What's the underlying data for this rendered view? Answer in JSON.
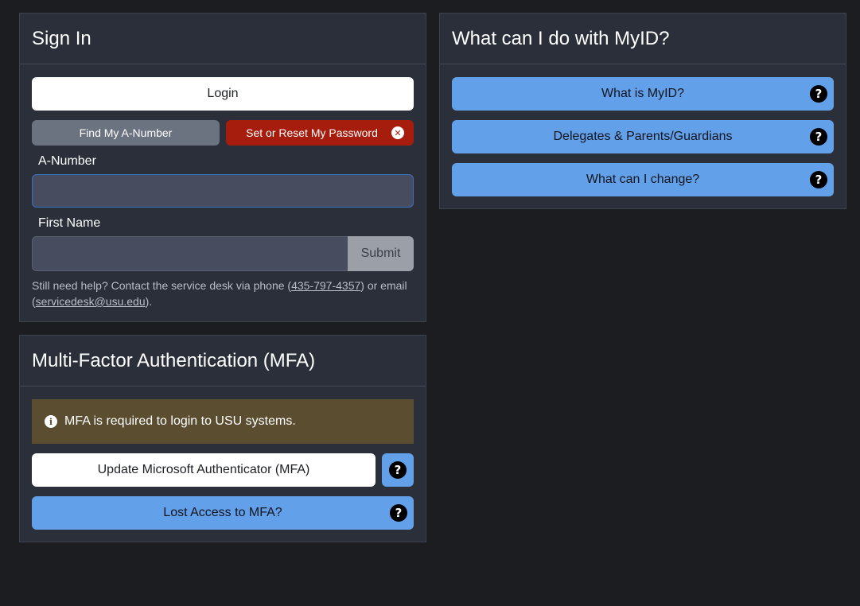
{
  "sign_in": {
    "title": "Sign In",
    "login_label": "Login",
    "find_anumber_label": "Find My A-Number",
    "reset_password_label": "Set or Reset My Password",
    "anumber_label": "A-Number",
    "anumber_value": "",
    "firstname_label": "First Name",
    "firstname_value": "",
    "submit_label": "Submit",
    "help_prefix": "Still need help? Contact the service desk via phone (",
    "help_phone": "435-797-4357",
    "help_middle": ") or email",
    "help_open": "(",
    "help_email": "servicedesk@usu.edu",
    "help_suffix": ")."
  },
  "mfa": {
    "title": "Multi-Factor Authentication (MFA)",
    "alert_text": "MFA is required to login to USU systems.",
    "update_label": "Update Microsoft Authenticator (MFA)",
    "lost_access_label": "Lost Access to MFA?"
  },
  "myid": {
    "title": "What can I do with MyID?",
    "items": [
      {
        "label": "What is MyID?"
      },
      {
        "label": "Delegates & Parents/Guardians"
      },
      {
        "label": "What can I change?"
      }
    ]
  },
  "icons": {
    "help": "question-circle-icon",
    "close": "x-circle-icon",
    "info": "info-circle-icon"
  },
  "colors": {
    "background": "#1b1d21",
    "card": "#2b2f3a",
    "blue_button": "#63a0ea",
    "red_button": "#a61d0d",
    "gray_button": "#6b7381",
    "alert_bg": "#5b4d30"
  }
}
